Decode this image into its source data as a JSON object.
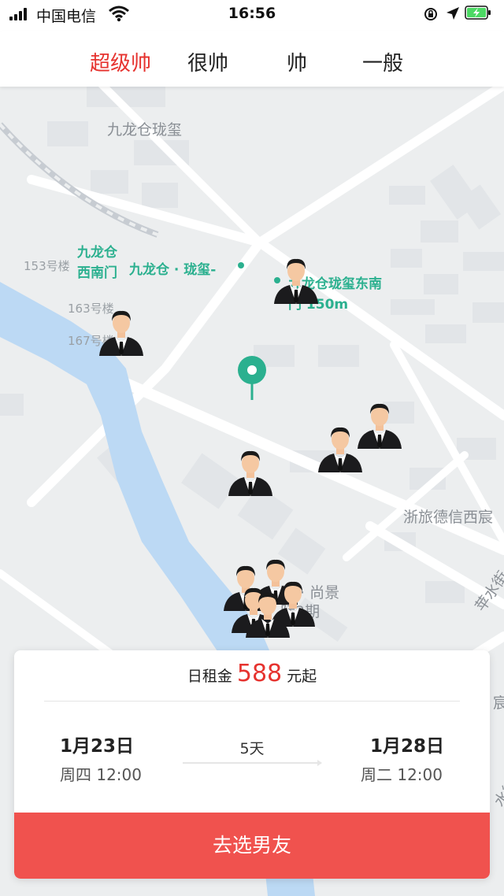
{
  "status_bar": {
    "carrier": "中国电信",
    "time": "16:56"
  },
  "tabs": [
    {
      "label": "超级帅",
      "active": true
    },
    {
      "label": "很帅",
      "active": false
    },
    {
      "label": "帅",
      "active": false
    },
    {
      "label": "一般",
      "active": false
    }
  ],
  "map": {
    "labels": {
      "estate_top": "九龙仓珑玺",
      "bldg_153": "153号楼",
      "bldg_163": "163号楼",
      "bldg_167": "167号楼",
      "west_gate_1": "九龙仓",
      "west_gate_2": "西南门",
      "estate_mid": "九龙仓 · 珑玺-",
      "east_gate_1": "九龙仓珑玺东南",
      "east_gate_2": "门 150m",
      "zhelv": "浙旅德信西宸",
      "shangjing_1": "阳 · 尚景",
      "shangjing_2": "际2期",
      "street": "苹水街",
      "street_2": "水街",
      "edge_right": "宸"
    },
    "pin_color": "#2bb08f",
    "icons": [
      "location-pin-icon",
      "person-icon"
    ]
  },
  "card": {
    "price_prefix": "日租金",
    "price": "588",
    "price_suffix": "元起",
    "start_date": "1月23日",
    "start_time": "周四 12:00",
    "duration": "5天",
    "end_date": "1月28日",
    "end_time": "周二 12:00",
    "cta_label": "去选男友"
  },
  "colors": {
    "accent": "#e6332f",
    "cta": "#f0524e",
    "river": "#bcd9f4",
    "map_green": "#2bb08f"
  }
}
